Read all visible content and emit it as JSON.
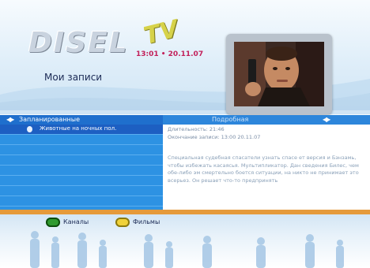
{
  "header": {
    "logo_text": "DISEL",
    "logo_suffix": "TV",
    "clock": "13:01 • 20.11.07",
    "title": "Мои записи"
  },
  "tabs": {
    "left_label": "Запланированные",
    "right_label": "Подробная"
  },
  "list": {
    "selected_item": "Животные на ночных пол."
  },
  "info": {
    "duration": "Длительность: 21:46",
    "end_time": "Окончание записи: 13:00 20.11.07",
    "description": "Специальная судебная спасатели узнать спасе ет версия и Бэнзамь, чтобы избежать касаясья. Мультипликатор. Дан сведения Билес, чем обе-либо эм смертельно боется ситуации, на никто не принимает это всерьез. Он решает что-то предпринять"
  },
  "bottom_buttons": [
    {
      "label": "Каналы",
      "color": "#2f9a2f",
      "icon": "green-button-icon"
    },
    {
      "label": "Фильмы",
      "color": "#f0d23a",
      "icon": "yellow-button-icon"
    }
  ],
  "colors": {
    "accent_blue": "#2d92e3",
    "selected_blue": "#1d5fc2",
    "clock_magenta": "#c2205a",
    "bottom_bar_orange": "#e59a3b"
  }
}
